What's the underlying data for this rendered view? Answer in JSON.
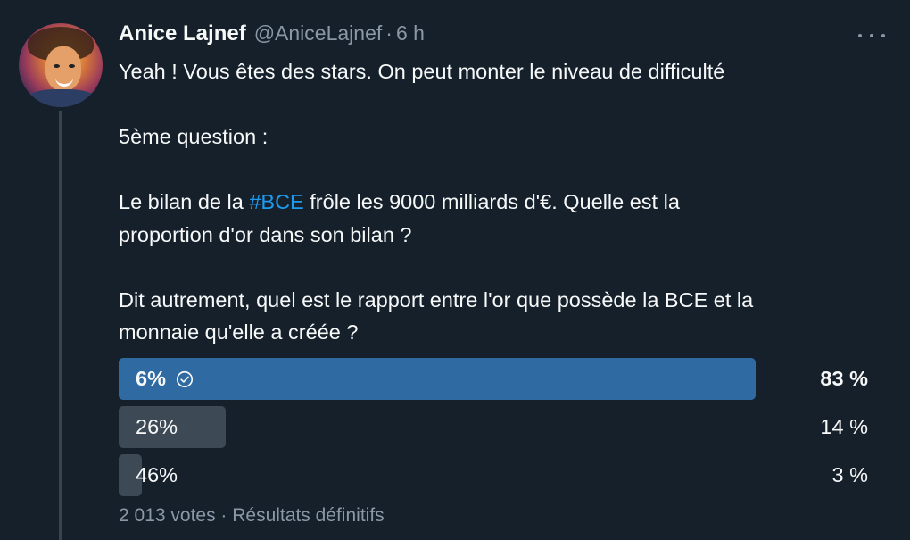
{
  "tweet": {
    "author": {
      "display_name": "Anice Lajnef",
      "handle": "@AniceLajnef",
      "separator": "·",
      "time": "6 h"
    },
    "text": {
      "line1": "Yeah ! Vous êtes des stars. On peut monter le niveau de difficulté",
      "line2": "5ème question :",
      "line3_before": "Le bilan de la ",
      "line3_hashtag": "#BCE",
      "line3_after": " frôle les 9000 milliards d'€. Quelle est la",
      "line4": "proportion d'or dans son bilan ?",
      "line5": "Dit autrement, quel est le rapport entre l'or que possède la BCE et la",
      "line6": "monnaie qu'elle a créée ?"
    }
  },
  "poll": {
    "options": [
      {
        "label": "6%",
        "percent_label": "83 %",
        "fraction": 0.83,
        "winner": true
      },
      {
        "label": "26%",
        "percent_label": "14 %",
        "fraction": 0.14,
        "winner": false
      },
      {
        "label": "46%",
        "percent_label": "3 %",
        "fraction": 0.03,
        "winner": false
      }
    ],
    "footer": "2 013 votes · Résultats définitifs"
  },
  "colors": {
    "background": "#15202b",
    "winner_bar": "#2f6aa3",
    "other_bar": "#3d4a56",
    "hashtag": "#1d9bf0",
    "muted_text": "#8b98a5"
  },
  "icons": [
    "more-icon",
    "check-circle-icon"
  ]
}
